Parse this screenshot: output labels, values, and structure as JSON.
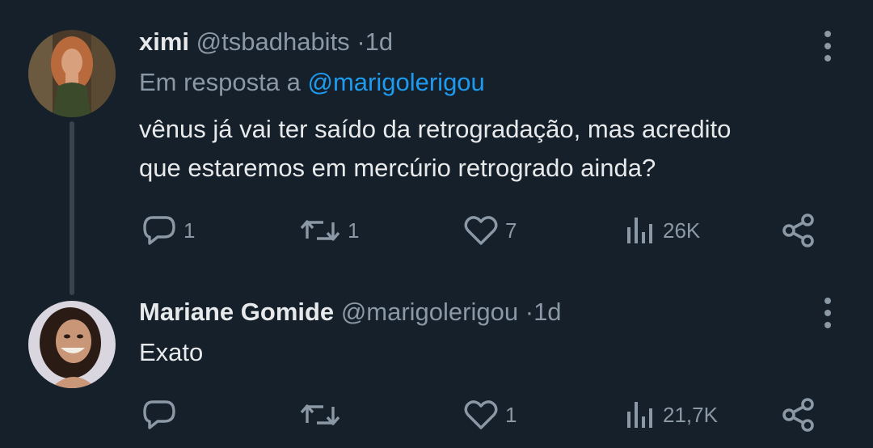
{
  "tweets": [
    {
      "name": "ximi",
      "handle": "@tsbadhabits",
      "separator": "·",
      "time": "1d",
      "reply_prefix": "Em resposta a",
      "reply_mention": "@marigolerigou",
      "text_line1": "vênus já vai ter saído da retrogradação, mas acredito",
      "text_line2": "que estaremos em mercúrio retrogrado ainda?",
      "stats": {
        "replies": "1",
        "retweets": "1",
        "likes": "7",
        "views": "26K"
      },
      "avatar_colors": {
        "bg": "#4a3a2a",
        "hair": "#b86a3c",
        "skin": "#d8a07c",
        "dress": "#3b4a2a"
      }
    },
    {
      "name": "Mariane Gomide",
      "handle": "@marigolerigou",
      "separator": "·",
      "time": "1d",
      "text": "Exato",
      "stats": {
        "replies": "",
        "retweets": "",
        "likes": "1",
        "views": "21,7K"
      },
      "avatar_colors": {
        "bg": "#d9d6e0",
        "hair": "#2a1c14",
        "skin": "#c99678"
      }
    }
  ],
  "icons": {
    "reply": "reply-icon",
    "retweet": "retweet-icon",
    "like": "heart-icon",
    "views": "views-icon",
    "share": "share-icon",
    "menu": "more-vertical-icon"
  },
  "colors": {
    "background": "#15202b",
    "text": "#e7e9ea",
    "muted": "#8b98a5",
    "accent": "#1d9bf0",
    "thread_line": "#38444d"
  }
}
